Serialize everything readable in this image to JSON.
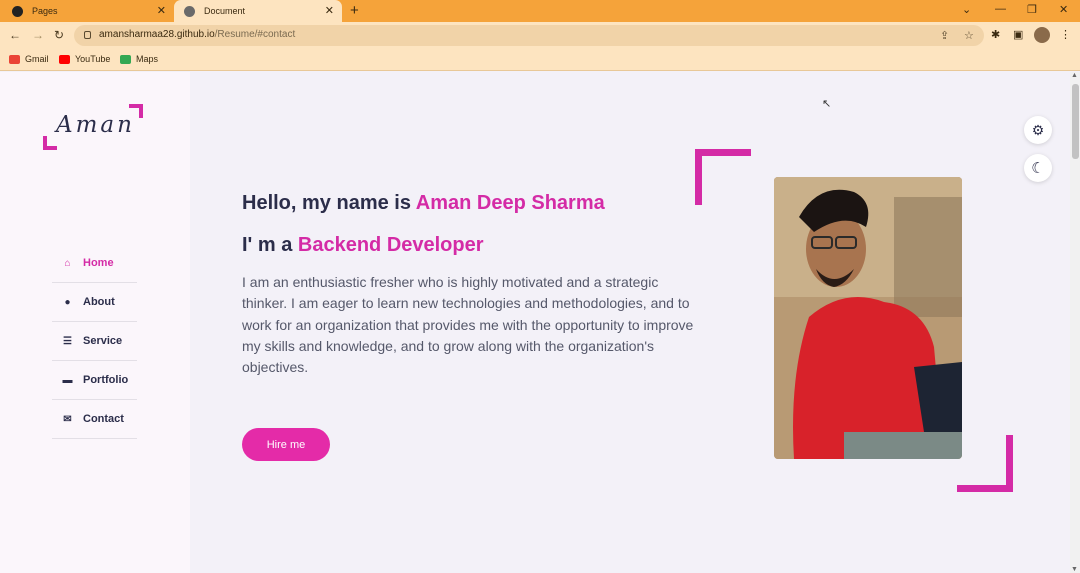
{
  "browser": {
    "tabs": [
      {
        "title": "Pages",
        "active": false
      },
      {
        "title": "Document",
        "active": true
      }
    ],
    "url_host": "amansharmaa28.github.io",
    "url_path": "/Resume/#contact",
    "bookmarks": [
      {
        "label": "Gmail",
        "color": "#ea4335"
      },
      {
        "label": "YouTube",
        "color": "#ff0000"
      },
      {
        "label": "Maps",
        "color": "#34a853"
      }
    ]
  },
  "site": {
    "logo": "Aman",
    "menu": [
      {
        "label": "Home",
        "icon": "home-icon",
        "glyph": "⌂",
        "active": true
      },
      {
        "label": "About",
        "icon": "user-icon",
        "glyph": "●",
        "active": false
      },
      {
        "label": "Service",
        "icon": "list-icon",
        "glyph": "☰",
        "active": false
      },
      {
        "label": "Portfolio",
        "icon": "briefcase-icon",
        "glyph": "▬",
        "active": false
      },
      {
        "label": "Contact",
        "icon": "comments-icon",
        "glyph": "✉",
        "active": false
      }
    ],
    "greeting_prefix": "Hello, my name is ",
    "name": "Aman Deep Sharma",
    "role_prefix": "I' m a ",
    "role": "Backend Developer",
    "description": "I am an enthusiastic fresher who is highly motivated and a strategic thinker. I am eager to learn new technologies and methodologies, and to work for an organization that provides me with the opportunity to improve my skills and knowledge, and to grow along with the organization's objectives.",
    "hire_label": "Hire me",
    "accent": "#d42ba6"
  }
}
